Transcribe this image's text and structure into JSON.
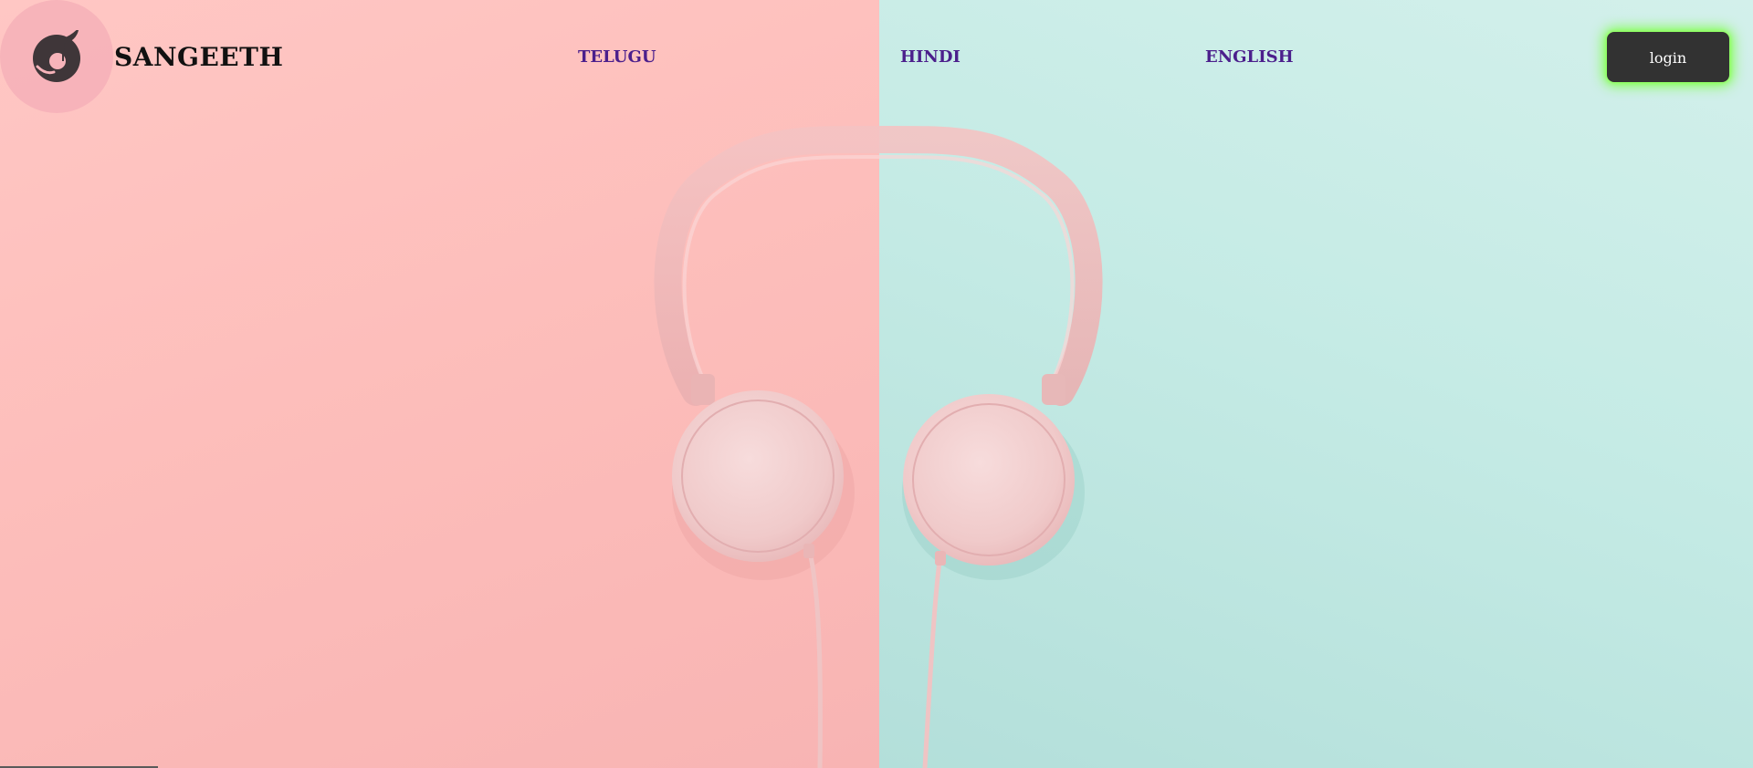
{
  "brand": {
    "name": "SANGEETH",
    "logo_icon": "music-note-logo-icon"
  },
  "nav": {
    "links": [
      {
        "label": "TELUGU"
      },
      {
        "label": "HINDI"
      },
      {
        "label": "ENGLISH"
      }
    ]
  },
  "actions": {
    "login_label": "login"
  },
  "hero": {
    "image_icon": "headphones-illustration"
  },
  "colors": {
    "left_background": "#fdbebb",
    "right_background": "#c5ebe5",
    "nav_link": "#4b1f8c",
    "login_background": "#323232",
    "login_glow": "#7dff4a",
    "logo_circle": "#f6b1b9"
  }
}
